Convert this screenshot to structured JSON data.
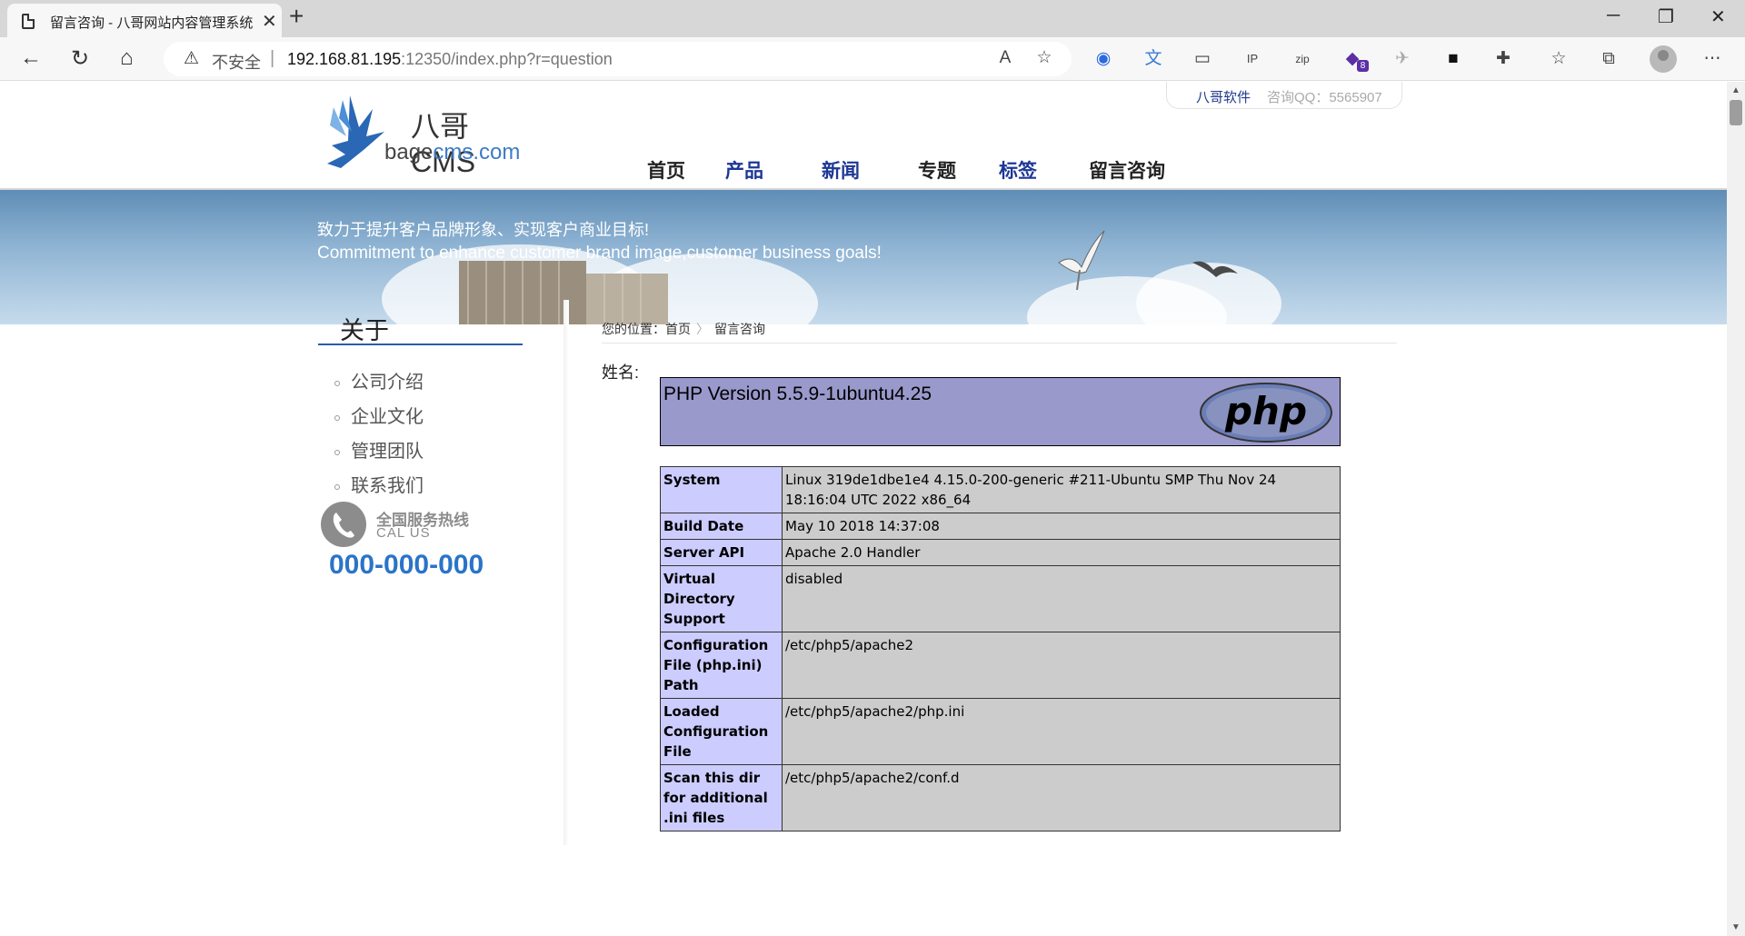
{
  "browser": {
    "tab_title": "留言咨询 - 八哥网站内容管理系统",
    "new_tab_symbol": "+",
    "tab_close_symbol": "✕",
    "window_controls": [
      "─",
      "❐",
      "✕"
    ],
    "security_label": "不安全",
    "url_separator": "|",
    "url_host": "192.168.81.195",
    "url_rest": ":12350/index.php?r=question",
    "toolbar_icons": [
      "read-aloud-icon",
      "favorite-add-icon",
      "extension-g-icon",
      "translate-icon",
      "laptop-icon",
      "ip-icon",
      "zip-icon",
      "purple-extension-icon",
      "bird-icon",
      "dark-extension-icon",
      "puzzle-icon",
      "favorites-icon",
      "collections-icon",
      "profile-icon",
      "more-icon"
    ],
    "extension_badge": "8"
  },
  "site": {
    "top_link": "八哥软件",
    "top_qq": "咨询QQ：5565907",
    "logo_cn": "八哥CMS",
    "logo_domain_pre": "bage",
    "logo_domain_post": "cms.com",
    "nav": [
      {
        "label": "首页",
        "color": "#222222"
      },
      {
        "label": "产品",
        "color": "#1d3795"
      },
      {
        "label": "新闻",
        "color": "#1d3795"
      },
      {
        "label": "专题",
        "color": "#222222"
      },
      {
        "label": "标签",
        "color": "#1d3795"
      },
      {
        "label": "留言咨询",
        "color": "#222222"
      }
    ],
    "slogan_cn": "致力于提升客户品牌形象、实现客户商业目标!",
    "slogan_en": "Commitment to enhance customer brand image,customer business goals!"
  },
  "sidebar": {
    "title": "关于",
    "items": [
      "公司介绍",
      "企业文化",
      "管理团队",
      "联系我们"
    ],
    "service_cn": "全国服务热线",
    "service_en": "CAL US",
    "hotline": "000-000-000"
  },
  "main": {
    "breadcrumb_prefix": "您的位置：",
    "breadcrumb_home": "首页",
    "breadcrumb_sep": "〉",
    "breadcrumb_current": "留言咨询",
    "name_label": "姓名:"
  },
  "phpinfo": {
    "version": "PHP Version 5.5.9-1ubuntu4.25",
    "logo_text": "php",
    "rows": [
      {
        "key": "System",
        "value": "Linux 319de1dbe1e4 4.15.0-200-generic #211-Ubuntu SMP Thu Nov 24 18:16:04 UTC 2022 x86_64"
      },
      {
        "key": "Build Date",
        "value": "May 10 2018 14:37:08"
      },
      {
        "key": "Server API",
        "value": "Apache 2.0 Handler"
      },
      {
        "key": "Virtual Directory Support",
        "value": "disabled"
      },
      {
        "key": "Configuration File (php.ini) Path",
        "value": "/etc/php5/apache2"
      },
      {
        "key": "Loaded Configuration File",
        "value": "/etc/php5/apache2/php.ini"
      },
      {
        "key": "Scan this dir for additional .ini files",
        "value": "/etc/php5/apache2/conf.d"
      }
    ]
  },
  "colors": {
    "php_header": "#9999cc",
    "php_key": "#ccccff",
    "php_value": "#cccccc",
    "hotline": "#2a74c8",
    "nav_blue": "#1d3795"
  }
}
